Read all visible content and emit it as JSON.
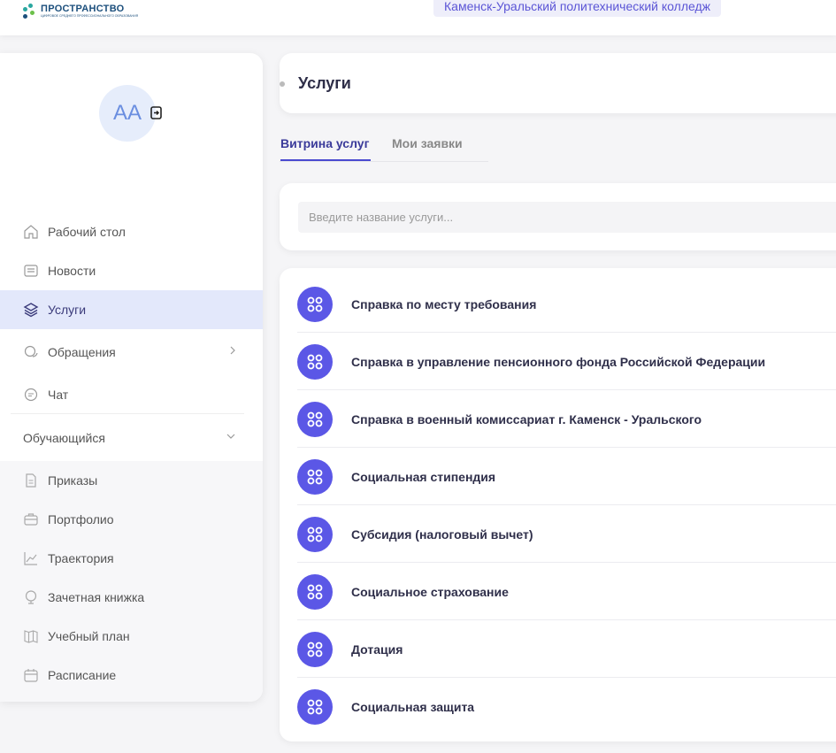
{
  "header": {
    "logo_main": "ПРОСТРАНСТВО",
    "logo_sub": "ЦИФРОВОЕ СРЕДНЕГО ПРОФЕССИОНАЛЬНОГО ОБРАЗОВАНИЯ",
    "college": "Каменск-Уральский политехнический колледж"
  },
  "profile": {
    "initials": "AA"
  },
  "sidebar": {
    "items": [
      {
        "label": "Рабочий стол",
        "icon": "home-icon"
      },
      {
        "label": "Новости",
        "icon": "news-icon"
      },
      {
        "label": "Услуги",
        "icon": "layers-icon",
        "active": true
      },
      {
        "label": "Обращения",
        "icon": "chat-bubbles-icon"
      },
      {
        "label": "Чат",
        "icon": "chat-icon"
      }
    ],
    "group": {
      "label": "Обучающийся"
    },
    "sub_items": [
      {
        "label": "Приказы",
        "icon": "document-icon"
      },
      {
        "label": "Портфолио",
        "icon": "briefcase-icon"
      },
      {
        "label": "Траектория",
        "icon": "trend-icon"
      },
      {
        "label": "Зачетная книжка",
        "icon": "grade-book-icon"
      },
      {
        "label": "Учебный план",
        "icon": "book-icon"
      },
      {
        "label": "Расписание",
        "icon": "calendar-icon"
      }
    ]
  },
  "page": {
    "title": "Услуги"
  },
  "tabs": [
    {
      "label": "Витрина услуг",
      "active": true
    },
    {
      "label": "Мои заявки",
      "active": false
    }
  ],
  "search": {
    "placeholder": "Введите название услуги..."
  },
  "services": [
    "Справка по месту требования",
    "Справка в управление пенсионного фонда Российской Федерации",
    "Справка в военный комиссариат г. Каменск - Уральского",
    "Социальная стипендия",
    "Субсидия (налоговый вычет)",
    "Социальное страхование",
    "Дотация",
    "Социальная защита"
  ],
  "colors": {
    "accent": "#5b57e6",
    "active_bg": "#e3e8fb"
  }
}
